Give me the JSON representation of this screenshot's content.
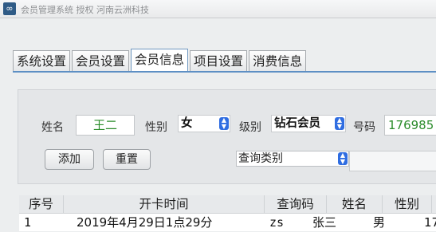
{
  "window": {
    "title": "会员管理系统 授权 河南云洲科技"
  },
  "tabs": [
    {
      "label": "系统设置",
      "active": false
    },
    {
      "label": "会员设置",
      "active": false
    },
    {
      "label": "会员信息",
      "active": true
    },
    {
      "label": "项目设置",
      "active": false
    },
    {
      "label": "消费信息",
      "active": false
    }
  ],
  "form": {
    "name_label": "姓名",
    "name_value": "王二",
    "gender_label": "性别",
    "gender_value": "女",
    "level_label": "级别",
    "level_value": "钻石会员",
    "phone_label": "号码",
    "phone_value": "176985",
    "add_button": "添加",
    "reset_button": "重置",
    "query_type_value": "查询类别"
  },
  "table": {
    "headers": [
      "序号",
      "开卡时间",
      "查询码",
      "姓名",
      "性别",
      ""
    ],
    "rows": [
      [
        "1",
        "2019年4月29日1点29分",
        "zs",
        "张三",
        "男",
        "17"
      ]
    ]
  },
  "colors": {
    "accent": "#5d8fc4",
    "input_text": "#2b8c2b",
    "select_arrow": "#2f6de1"
  }
}
